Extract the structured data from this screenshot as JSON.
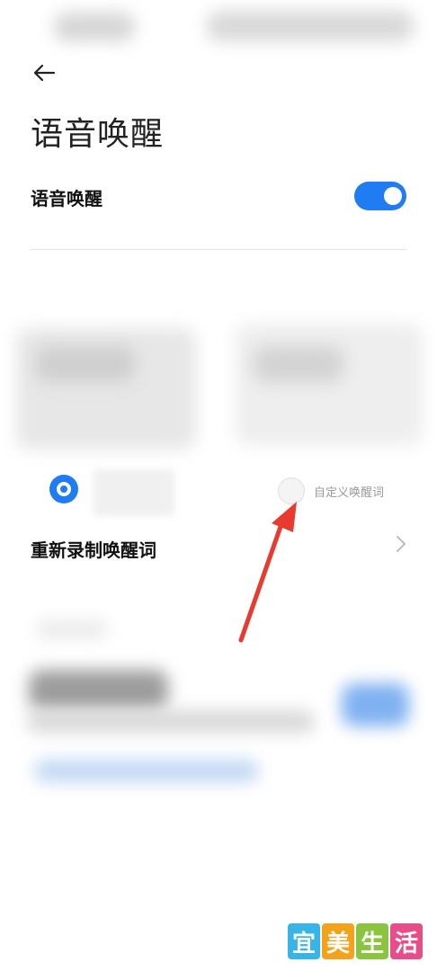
{
  "header": {
    "title": "语音唤醒"
  },
  "voice_wakeup": {
    "label": "语音唤醒",
    "enabled": true
  },
  "wake_word_options": {
    "selected_index": 0,
    "custom_label": "自定义唤醒词"
  },
  "rerecord": {
    "label": "重新录制唤醒词"
  },
  "watermark": {
    "chars": [
      "宜",
      "美",
      "生",
      "活"
    ]
  },
  "colors": {
    "accent": "#1f7cf2",
    "arrow": "#e83a2e"
  }
}
